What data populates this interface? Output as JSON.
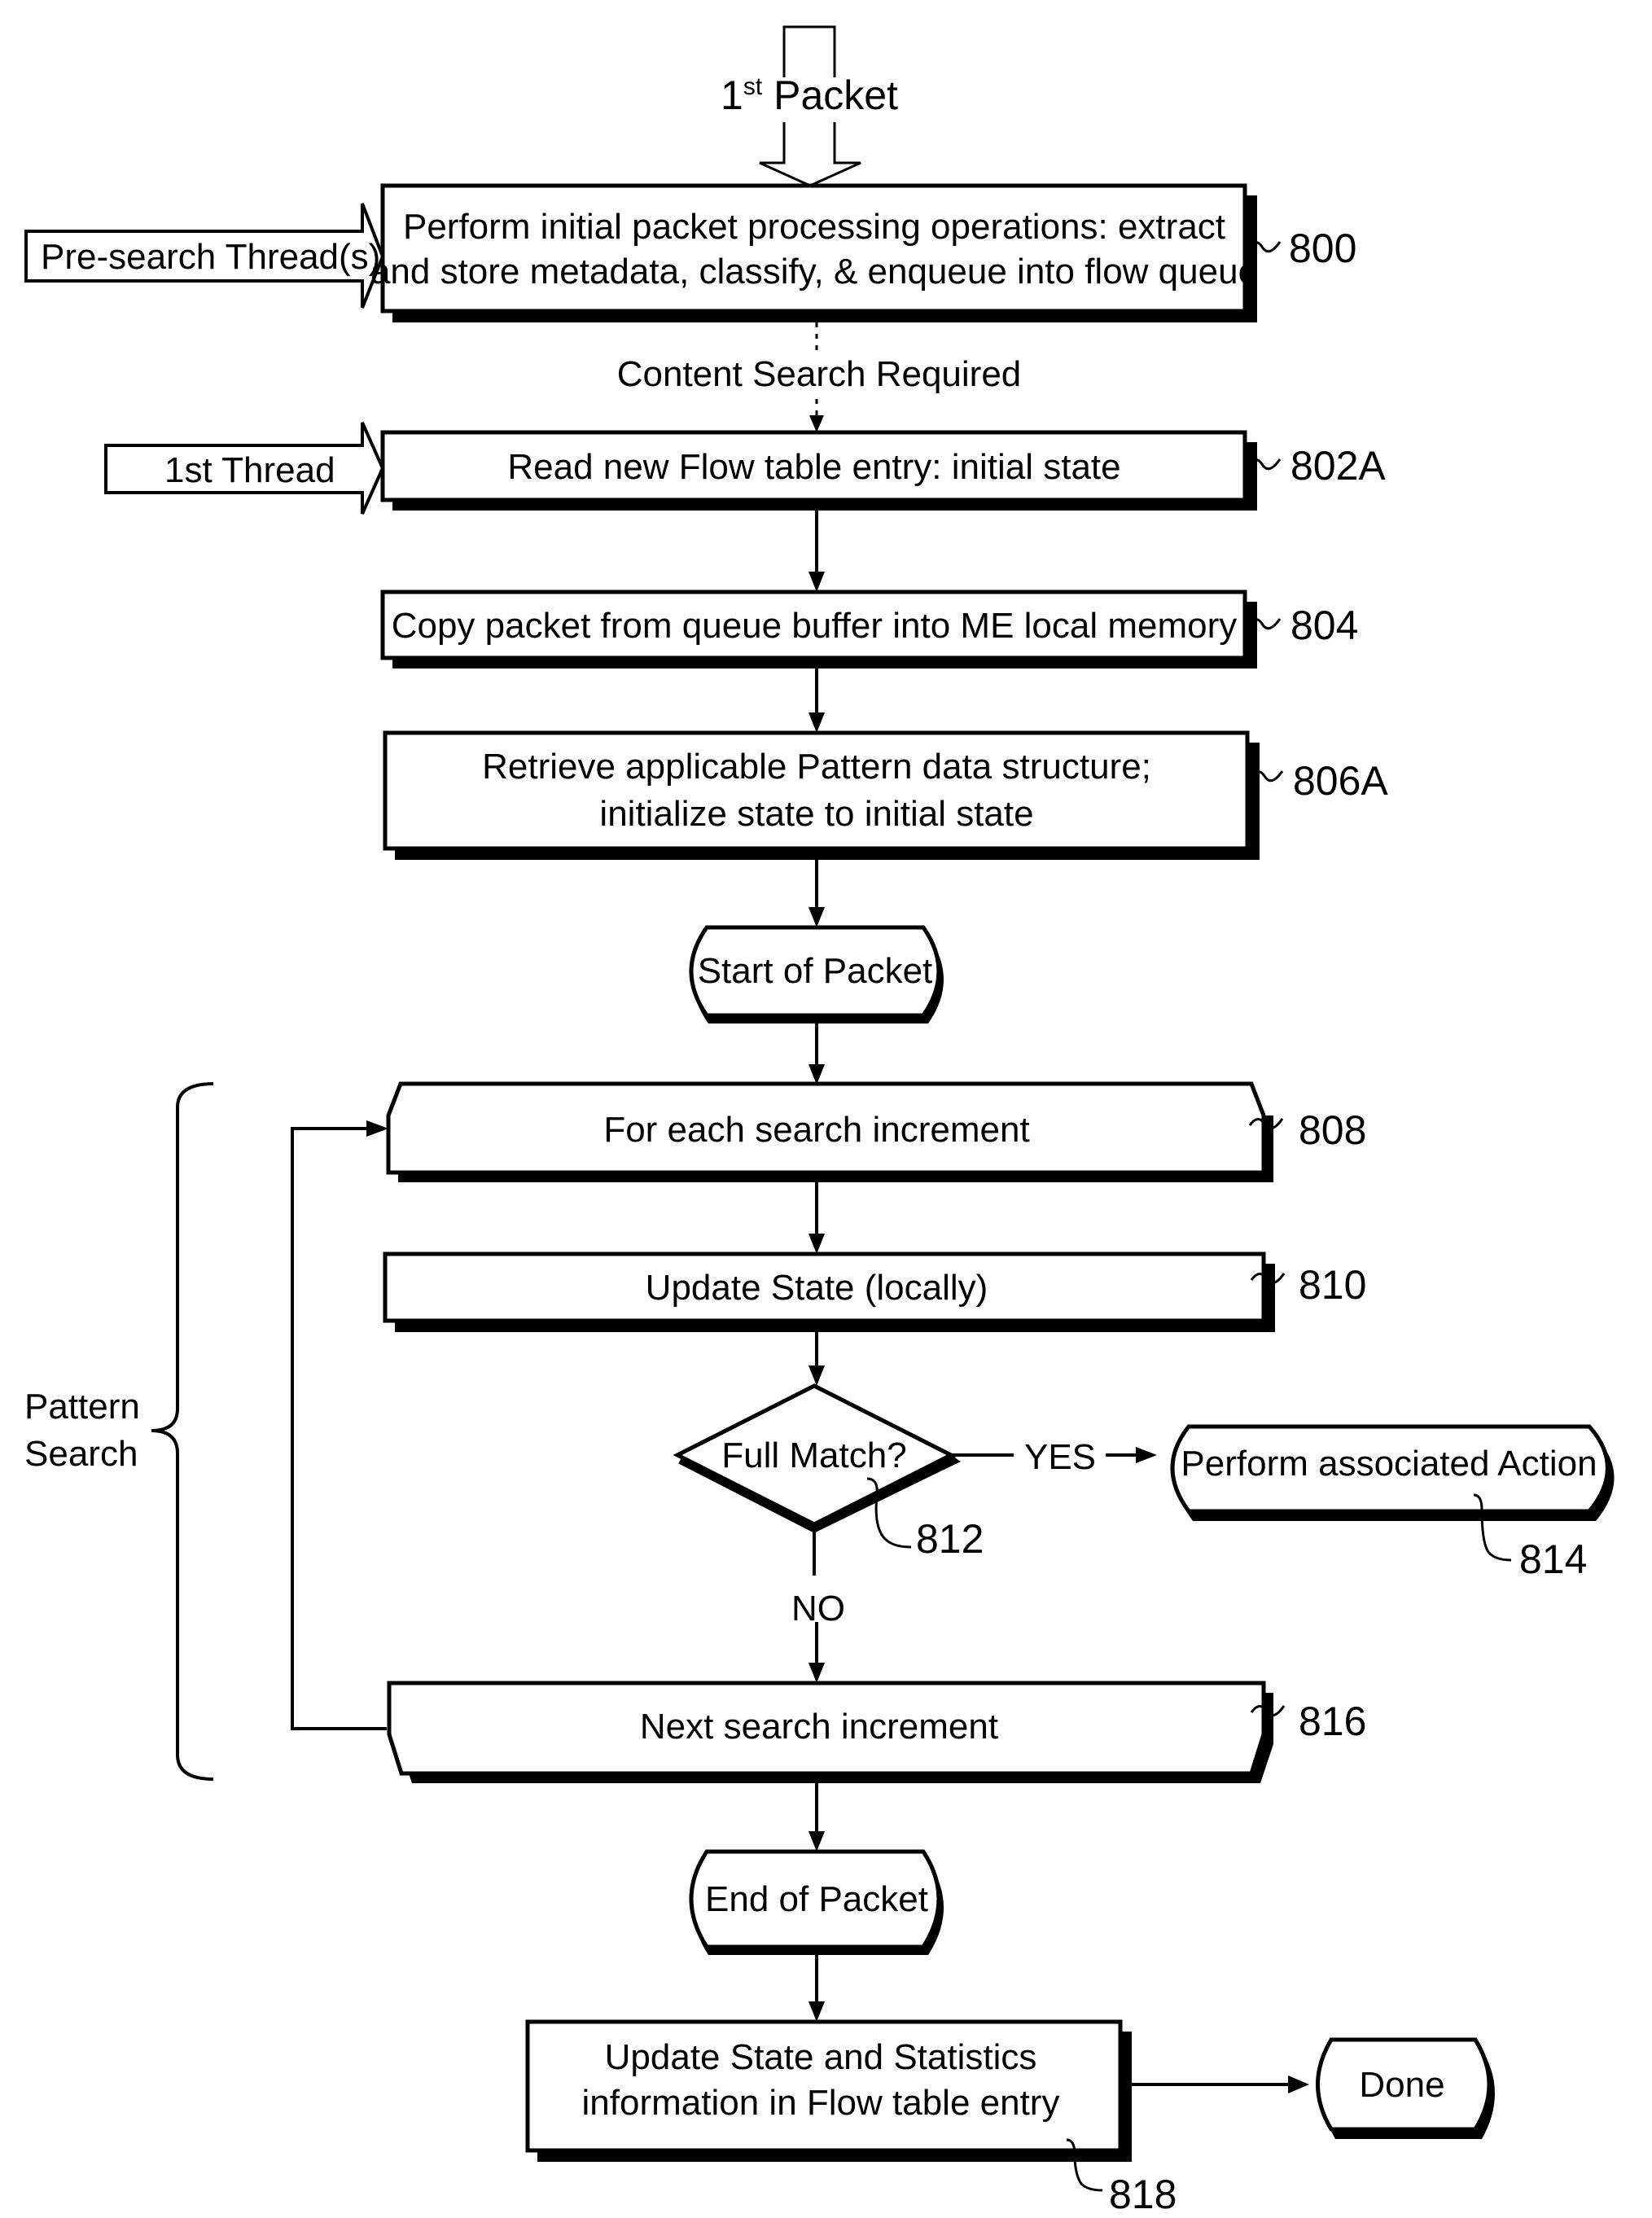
{
  "figure": {
    "input": {
      "label_prefix": "1",
      "label_superscript": "st",
      "label_suffix": " Packet"
    },
    "threads": {
      "pre_search": "Pre-search Thread(s)",
      "first": "1st Thread"
    },
    "connector_labels": {
      "content_search": "Content Search Required",
      "yes": "YES",
      "no": "NO"
    },
    "group_label": {
      "line1": "Pattern",
      "line2": "Search"
    },
    "steps": {
      "s800": {
        "ref": "800",
        "line1": "Perform initial packet processing operations:  extract",
        "line2": "and store metadata, classify, & enqueue into flow queue"
      },
      "s802a": {
        "ref": "802A",
        "line1": "Read new Flow table entry: initial state"
      },
      "s804": {
        "ref": "804",
        "line1": "Copy packet from queue buffer into ME local memory"
      },
      "s806a": {
        "ref": "806A",
        "line1": "Retrieve applicable Pattern data structure;",
        "line2": "initialize state to initial state"
      },
      "start": {
        "line1": "Start of Packet"
      },
      "s808": {
        "ref": "808",
        "line1": "For each search increment"
      },
      "s810": {
        "ref": "810",
        "line1": "Update State (locally)"
      },
      "s812": {
        "ref": "812",
        "line1": "Full Match?"
      },
      "s814": {
        "ref": "814",
        "line1": "Perform associated Action"
      },
      "s816": {
        "ref": "816",
        "line1": "Next search increment"
      },
      "end": {
        "line1": "End of Packet"
      },
      "s818": {
        "ref": "818",
        "line1": "Update State and Statistics",
        "line2": "information in Flow table entry"
      },
      "done": {
        "line1": "Done"
      }
    }
  }
}
